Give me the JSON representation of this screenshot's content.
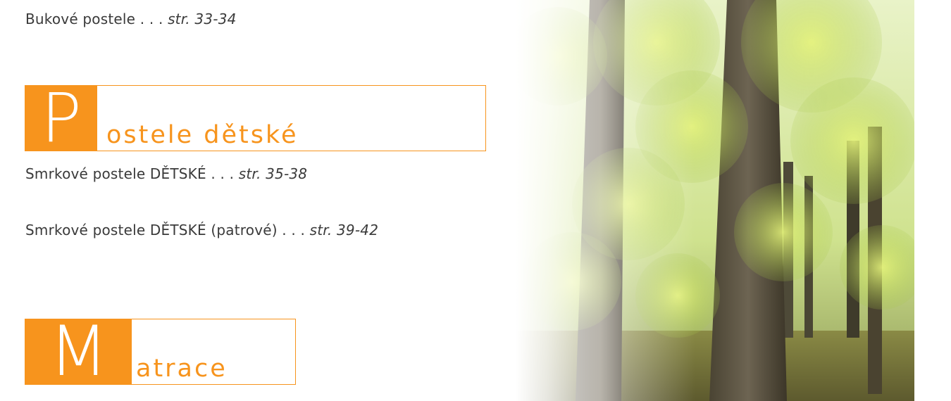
{
  "sections": [
    {
      "entries": [
        {
          "text": "Bukové postele . . . ",
          "page": "str. 33-34"
        }
      ]
    },
    {
      "heading": {
        "capital": "P",
        "rest": "ostele dětské"
      },
      "entries": [
        {
          "text": "Smrkové postele DĚTSKÉ . . . ",
          "page": "str. 35-38"
        },
        {
          "text": "Smrkové postele DĚTSKÉ (patrové) . . . ",
          "page": "str. 39-42"
        }
      ]
    },
    {
      "heading": {
        "capital": "M",
        "rest": "atrace"
      }
    }
  ],
  "colors": {
    "accent": "#f7941d",
    "text": "#3a3a3a"
  },
  "image": {
    "subject": "forest-photo"
  }
}
